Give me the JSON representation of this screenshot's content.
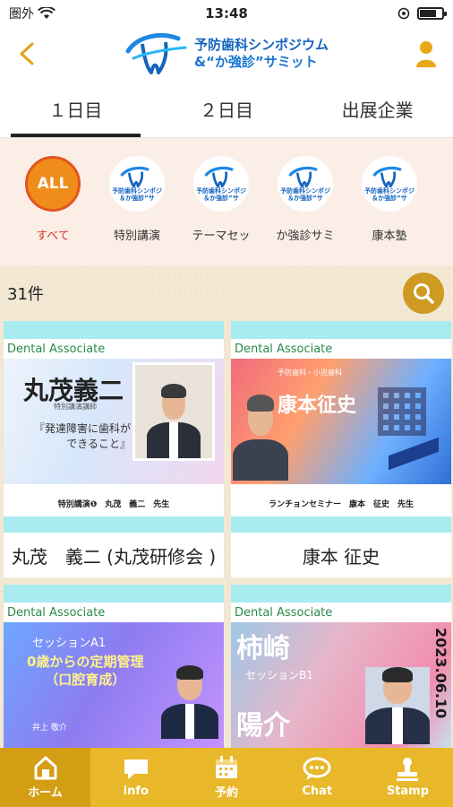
{
  "status": {
    "carrier": "圏外",
    "time": "13:48"
  },
  "header": {
    "logo_line1": "予防歯科シンポジウム",
    "logo_line2": "&“か強診”サミット"
  },
  "tabs": [
    {
      "label": "１日目",
      "active": true
    },
    {
      "label": "２日目",
      "active": false
    },
    {
      "label": "出展企業",
      "active": false
    }
  ],
  "categories": [
    {
      "label": "すべて",
      "circle": "ALL",
      "active": true
    },
    {
      "label": "特別講演",
      "active": false
    },
    {
      "label": "テーマセッ",
      "active": false
    },
    {
      "label": "か強診サミ",
      "active": false
    },
    {
      "label": "康本塾",
      "active": false
    }
  ],
  "mini_logo": {
    "line1": "予防歯科シンポジ",
    "line2": "＆か強診”サ"
  },
  "count_label": "31件",
  "cards": [
    {
      "brand": "Dental Associate",
      "visual_name": "丸茂義二",
      "visual_sub": "特別講演講師",
      "visual_quote": "『発達障害に歯科が\nできること』",
      "caption": "特別講演❶　丸茂　義二　先生",
      "title": "丸茂　義二 (丸茂研修会 )"
    },
    {
      "brand": "Dental Associate",
      "visual_name": "康本征史",
      "visual_sub": "予防歯科・小児歯科",
      "caption": "ランチョンセミナー　康本　征史　先生",
      "title": "康本 征史"
    },
    {
      "brand": "Dental Associate",
      "visual_session": "セッションA1",
      "visual_title": "0歳からの定期管理\n（口腔育成）",
      "visual_speaker": "井上 敬介"
    },
    {
      "brand": "Dental Associate",
      "visual_name": "柿崎",
      "visual_name2": "陽介",
      "visual_session": "セッションB1",
      "visual_date": "2023.06.10"
    }
  ],
  "bottom_nav": [
    {
      "label": "ホーム",
      "icon": "home-icon",
      "active": true
    },
    {
      "label": "info",
      "icon": "chat-bubble-icon",
      "active": false
    },
    {
      "label": "予約",
      "icon": "calendar-icon",
      "active": false
    },
    {
      "label": "Chat",
      "icon": "chat-dots-icon",
      "active": false
    },
    {
      "label": "Stamp",
      "icon": "stamp-icon",
      "active": false
    }
  ],
  "colors": {
    "accent": "#e8b82a",
    "back_arrow": "#e3a21a",
    "category_bg": "#fbeee6",
    "all_circle": "#ef8c1a",
    "active_label": "#d23b2d",
    "search_button": "#cf9a22"
  }
}
